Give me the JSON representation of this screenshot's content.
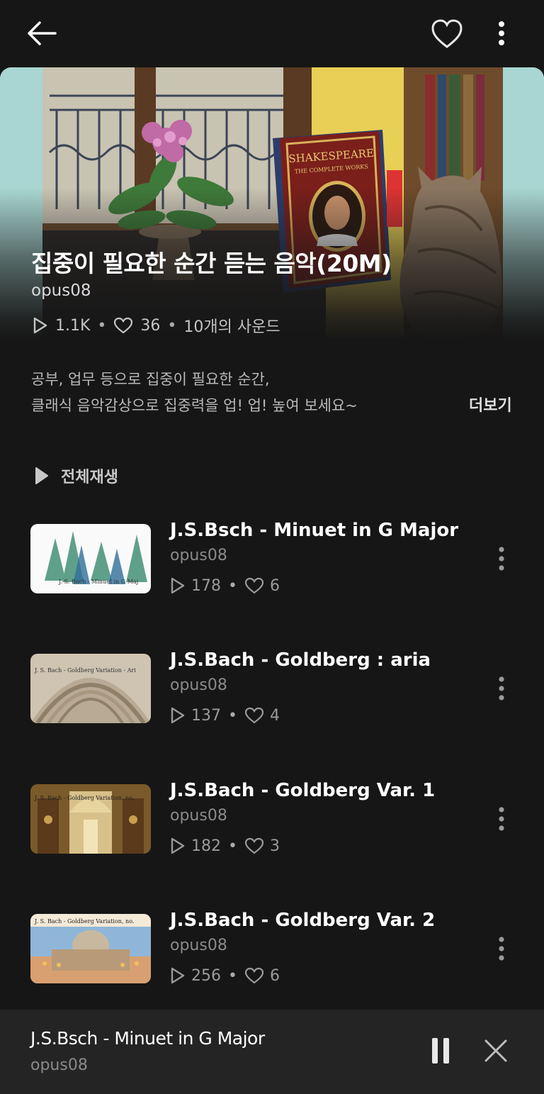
{
  "header": {
    "back_icon": "back-arrow-icon",
    "like_icon": "heart-outline-icon",
    "more_icon": "more-vertical-icon"
  },
  "playlist": {
    "title": "집중이 필요한 순간 듣는 음악(20M)",
    "artist": "opus08",
    "plays": "1.1K",
    "likes": "36",
    "sound_count": "10개의 사운드",
    "description_line1": "공부, 업무 등으로 집중이 필요한 순간,",
    "description_line2": "클래식 음악감상으로 집중력을 업! 업! 높여 보세요~",
    "more_label": "더보기",
    "play_all_label": "전체재생"
  },
  "tracks": [
    {
      "title": "J.S.Bsch - Minuet in G Major",
      "artist": "opus08",
      "plays": "178",
      "likes": "6"
    },
    {
      "title": "J.S.Bach - Goldberg : aria",
      "artist": "opus08",
      "plays": "137",
      "likes": "4"
    },
    {
      "title": "J.S.Bach - Goldberg Var. 1",
      "artist": "opus08",
      "plays": "182",
      "likes": "3"
    },
    {
      "title": "J.S.Bach - Goldberg Var. 2",
      "artist": "opus08",
      "plays": "256",
      "likes": "6"
    }
  ],
  "thumb_captions": {
    "t0": "J. S. Bach - Minuet in G Maj",
    "t1": "J. S. Bach - Goldberg Variation - Ari",
    "t2": "J. S. Bach - Goldberg Variation, no.",
    "t3": "J. S. Bach - Goldberg Variation, no."
  },
  "book_text": {
    "title": "SHAKESPEARE",
    "subtitle": "THE COMPLETE WORKS"
  },
  "mini_player": {
    "title": "J.S.Bsch - Minuet in G Major",
    "artist": "opus08",
    "pause_icon": "pause-icon",
    "close_icon": "close-icon"
  },
  "colors": {
    "background": "#161616",
    "mini_player_bg": "#242424",
    "text_primary": "#ffffff",
    "text_secondary": "#8a8a8a"
  }
}
